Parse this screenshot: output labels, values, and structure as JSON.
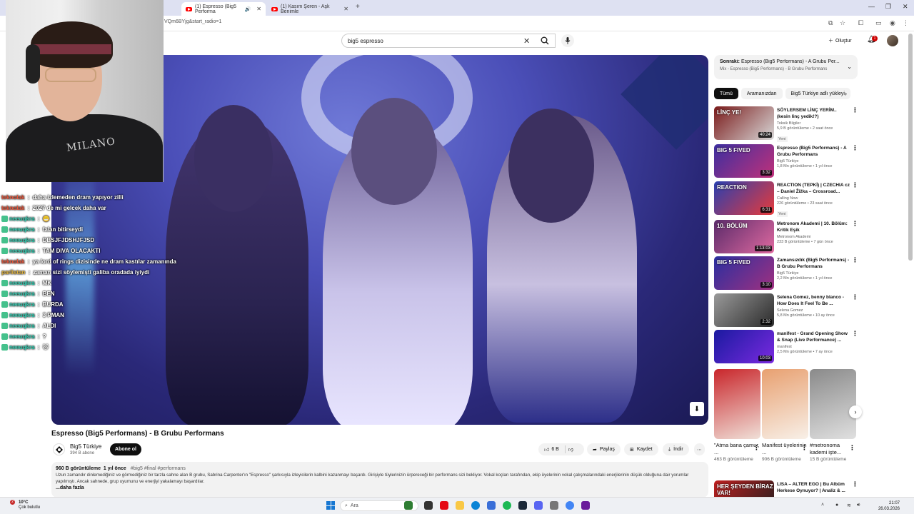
{
  "browser": {
    "tabs": [
      {
        "title": "(1) Espresso (Big5 Performa",
        "active": true
      },
      {
        "title": "(1) Kasım Şeren - Aşk Benimle",
        "active": false
      }
    ],
    "url": "VQm6BYjg&start_radio=1"
  },
  "header": {
    "search_value": "big5 espresso",
    "create_label": "Oluştur",
    "notifications_count": "1"
  },
  "video": {
    "title": "Espresso (Big5 Performans) - B Grubu Performans",
    "channel": {
      "name": "Big5 Türkiye",
      "subscribers": "394 B abone"
    },
    "subscribe_label": "Abone ol",
    "actions": {
      "likes": "6 B",
      "share": "Paylaş",
      "save": "Kaydet",
      "download": "İndir"
    },
    "description": {
      "views": "960 B görüntüleme",
      "date": "1 yıl önce",
      "tags": "#big5 #final #performans",
      "text": "Uzun zamandır dinlemediğiniz ve görmediğiniz bir tarzla sahne alan B grubu, Sabrina Carpenter'ın \"Espresso\" şarkısıyla izleyicilerin kalbini kazanmayı başardı. Girişiyle tüylerinizin ürpereceği bir performans sizi bekliyor. Vokal koçları tarafından, ekip üyelerinin vokal çalışmalarındaki enerjilerinin düşük olduğuna dair yorumlar yapılmıştı. Ancak sahnede, grup uyumunu ve enerjiyi yakalamayı başardılar.",
      "more": "...daha fazla"
    }
  },
  "chat": [
    {
      "user": "teknolak",
      "text": "daha izlemeden dram yapıyor zilli",
      "color": "t"
    },
    {
      "user": "teknolak",
      "text": "2027 de mi gelcek daha var",
      "color": "t"
    },
    {
      "user": "neeuqkra",
      "text": "😬",
      "color": "n"
    },
    {
      "user": "neeuqkra",
      "text": "falan bitirseydi",
      "color": "n"
    },
    {
      "user": "neeuqkra",
      "text": "DBSJFJDSHJFJSD",
      "color": "n"
    },
    {
      "user": "neeuqkra",
      "text": "TAM DIVA OLACAKTI",
      "color": "n"
    },
    {
      "user": "teknolak",
      "text": "ya lord of rings dizisinde ne dram kastılar zamanında",
      "color": "t"
    },
    {
      "user": "parlistan",
      "text": "zaman sizi söylemişti galiba oradada iyiydi",
      "color": "p"
    },
    {
      "user": "neeuqkra",
      "text": "MK",
      "color": "n"
    },
    {
      "user": "neeuqkra",
      "text": "BEN",
      "color": "n"
    },
    {
      "user": "neeuqkra",
      "text": "BURDA",
      "color": "n"
    },
    {
      "user": "neeuqkra",
      "text": "3 PMAN",
      "color": "n"
    },
    {
      "user": "neeuqkra",
      "text": "ALDI",
      "color": "n"
    },
    {
      "user": "neeuqkra",
      "text": "?",
      "color": "n"
    },
    {
      "user": "neeuqkra",
      "text": "🐱",
      "color": "n"
    }
  ],
  "webcam": {
    "shirt_text": "MILANO"
  },
  "sidebar": {
    "up_next_label": "Sonraki:",
    "up_next_title": "Espresso (Big5 Performans) - A Grubu Per...",
    "up_next_sub": "Mix - Espresso (Big5 Performans) - B Grubu Performans",
    "chips": [
      "Tümü",
      "Aramanızdan",
      "Big5 Türkiye adlı yükleyi"
    ],
    "recommendations": [
      {
        "title": "SÖYLERSEM LİNÇ YERİM.. (kesin linç yedik!?)",
        "channel": "Toksik Bilgiler",
        "views": "5,9 B görüntüleme • 2 saat önce",
        "badge": "Yeni",
        "duration": "40:24",
        "thumb_text": "LİNÇ YE!",
        "c1": "#7a1a1a",
        "c2": "#d8d8d8"
      },
      {
        "title": "Espresso (Big5 Performans) - A Grubu Performans",
        "channel": "Big5 Türkiye",
        "views": "1,8 Mn görüntüleme • 1 yıl önce",
        "badge": "",
        "duration": "3:32",
        "thumb_text": "BIG 5 FIVED",
        "c1": "#3c2fa0",
        "c2": "#c0307a"
      },
      {
        "title": "REACTION (TEPKİ) | CZECHIA cz – Daniel Žižka – Crossroad...",
        "channel": "Calling Now",
        "views": "226 görüntüleme • 23 saat önce",
        "badge": "Yeni",
        "duration": "6:31",
        "thumb_text": "REACTION",
        "c1": "#2a3fb0",
        "c2": "#e83a3a"
      },
      {
        "title": "Metronom Akademi | 10. Bölüm: Kritik Eşik",
        "channel": "Metronom Akademi",
        "views": "233 B görüntüleme • 7 gün önce",
        "badge": "",
        "duration": "1:13:03",
        "thumb_text": "10. BÖLÜM",
        "c1": "#5a2a6a",
        "c2": "#e06aa0"
      },
      {
        "title": "Zamansızdık (Big5 Performans) - B Grubu Performans",
        "channel": "Big5 Türkiye",
        "views": "2,2 Mn görüntüleme • 1 yıl önce",
        "badge": "",
        "duration": "3:10",
        "thumb_text": "BIG 5 FIVED",
        "c1": "#2a2fa0",
        "c2": "#a03080"
      },
      {
        "title": "Selena Gomez, benny blanco - How Does It Feel To Be ...",
        "channel": "Selena Gomez",
        "views": "5,8 Mn görüntüleme • 10 ay önce",
        "badge": "",
        "duration": "2:32",
        "thumb_text": "",
        "c1": "#9a9a9a",
        "c2": "#2a2a2a"
      },
      {
        "title": "manifest - Grand Opening Show & Snap (Live Performance) ...",
        "channel": "manifest",
        "views": "2,5 Mn görüntüleme • 7 ay önce",
        "badge": "",
        "duration": "10:03",
        "thumb_text": "",
        "c1": "#1a1aa0",
        "c2": "#7a2ae0"
      }
    ],
    "shorts": [
      {
        "title": "\"Atma bana çamur, ...",
        "views": "463 B görüntüleme",
        "c1": "#c9262b",
        "c2": "#f0e0d8"
      },
      {
        "title": "Manifest üyelerinin ...",
        "views": "906 B görüntüleme",
        "c1": "#e8a070",
        "c2": "#f8f0e8"
      },
      {
        "title": "#metronoma kademi işte...",
        "views": "15 B görüntüleme",
        "c1": "#8a8a8a",
        "c2": "#e0e0e0"
      }
    ],
    "last": {
      "title": "LISA – ALTER EGO | Bu Albüm Herkese Oynuyor? | Analiz & ...",
      "thumb_text": "HER ŞEYDEN BİRAZ VAR!",
      "c1": "#c02020",
      "c2": "#202020"
    }
  },
  "taskbar": {
    "temp": "10°C",
    "weather": "Çok bulutlu",
    "weather_badge": "2",
    "search_placeholder": "Ara",
    "time": "21:07",
    "date": "26.03.2026"
  }
}
